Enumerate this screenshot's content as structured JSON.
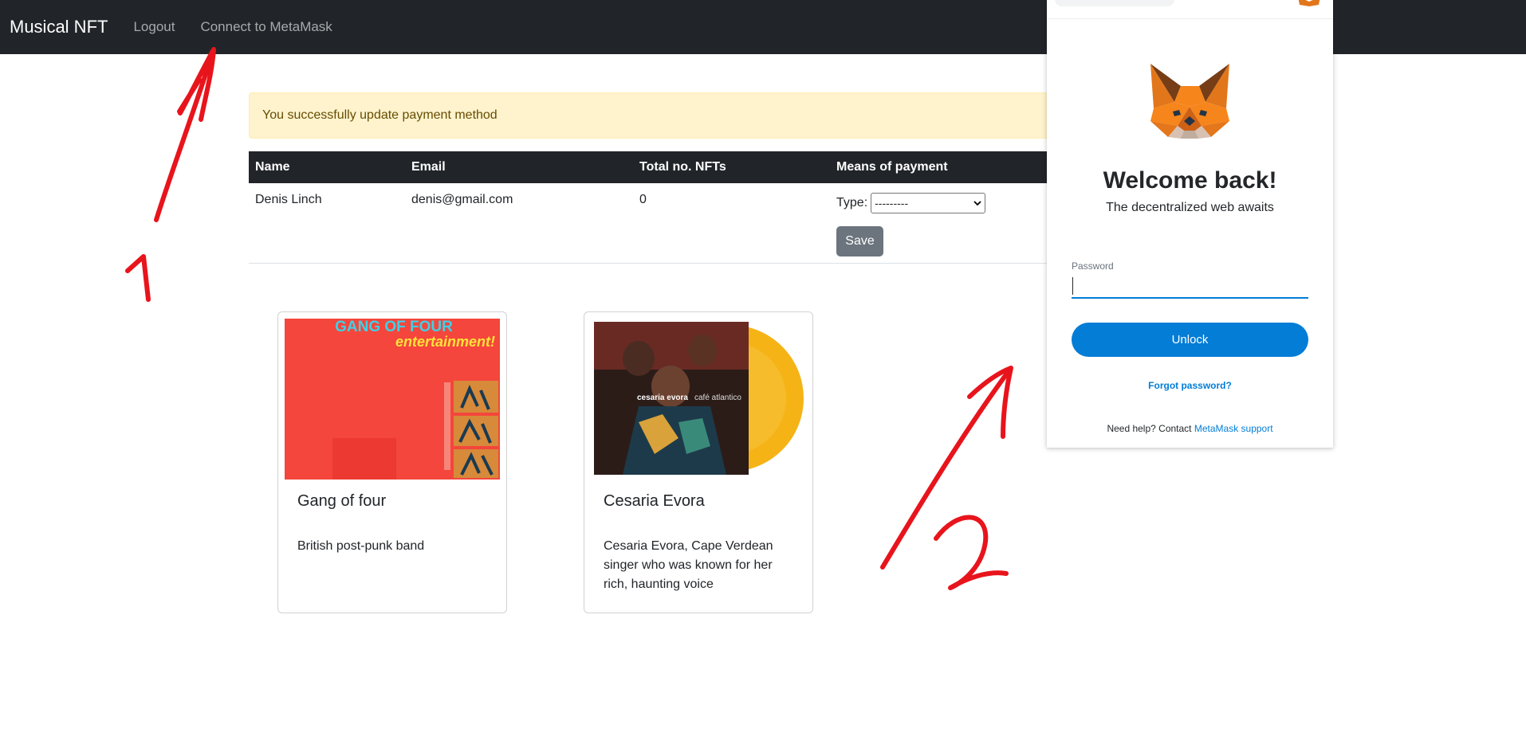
{
  "navbar": {
    "brand": "Musical NFT",
    "links": [
      "Logout",
      "Connect to MetaMask"
    ]
  },
  "alert": {
    "message": "You successfully update payment method"
  },
  "user_table": {
    "headers": [
      "Name",
      "Email",
      "Total no. NFTs",
      "Means of payment"
    ],
    "row": {
      "name": "Denis Linch",
      "email": "denis@gmail.com",
      "total_nfts": "0",
      "type_label": "Type:",
      "type_selected": "---------",
      "save_label": "Save"
    }
  },
  "cards": [
    {
      "title": "Gang of four",
      "description": "British post-punk band",
      "image_text_1": "GANG OF FOUR",
      "image_text_2": "entertainment!"
    },
    {
      "title": "Cesaria Evora",
      "description": "Cesaria Evora, Cape Verdean singer who was known for her rich, haunting voice",
      "image_text_1": "cesaria evora",
      "image_text_2": "café atlantico"
    }
  ],
  "metamask": {
    "welcome": "Welcome back!",
    "subtitle": "The decentralized web awaits",
    "password_label": "Password",
    "unlock_label": "Unlock",
    "forgot_label": "Forgot password?",
    "help_text": "Need help? Contact ",
    "help_link": "MetaMask support"
  },
  "annotations": {
    "marker_1": "1",
    "marker_2": "2"
  },
  "colors": {
    "navbar": "#212529",
    "alert_bg": "#fff3cd",
    "alert_text": "#664d03",
    "metamask_blue": "#037dd6",
    "annotation_red": "#e8141c",
    "save_button": "#6c757d"
  }
}
